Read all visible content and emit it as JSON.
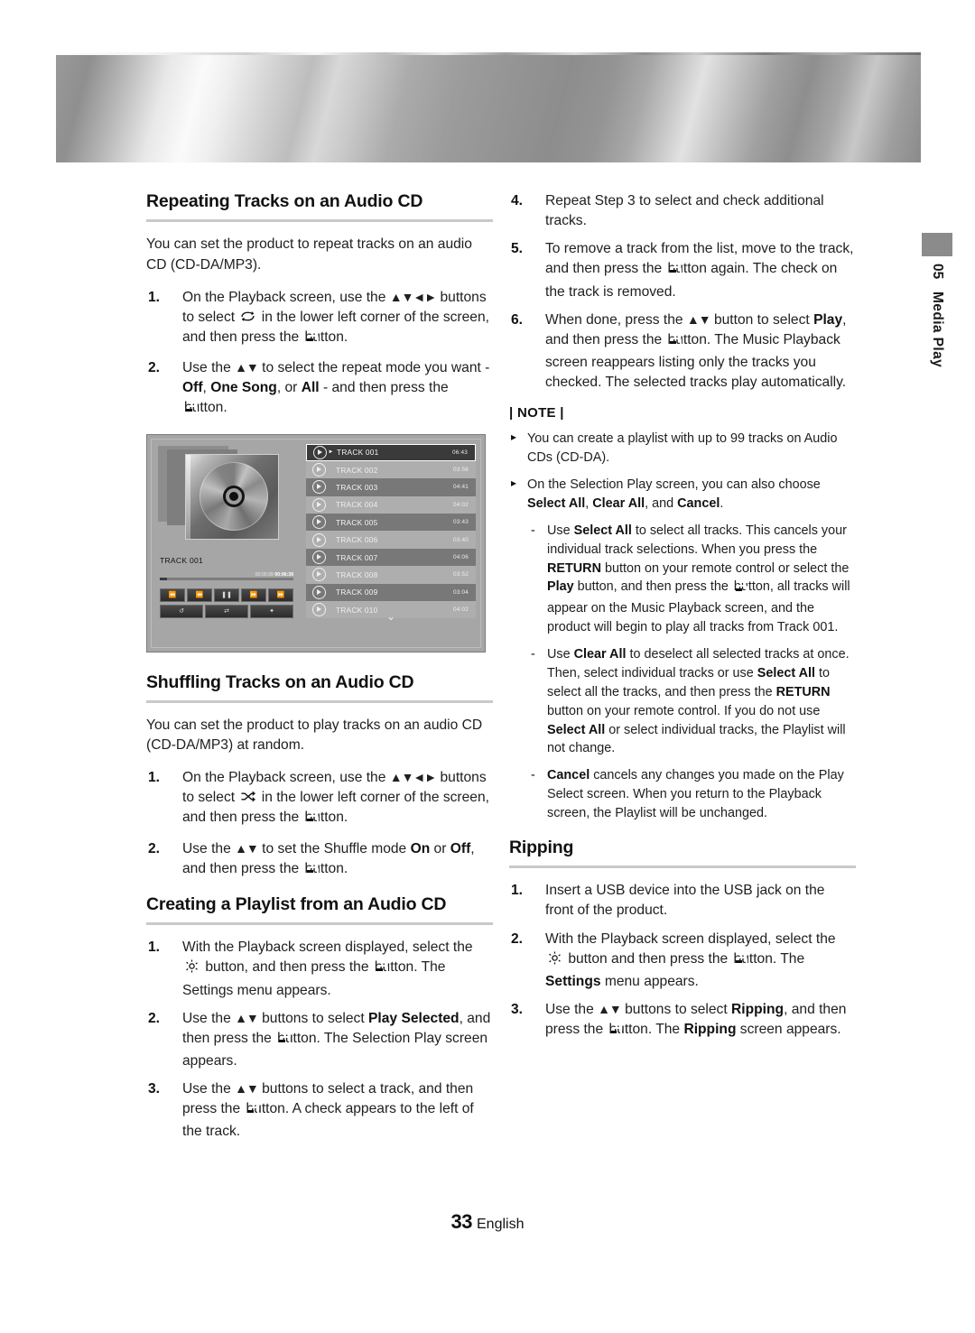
{
  "side_tab": {
    "number": "05",
    "label": "Media Play"
  },
  "footer": {
    "page_number": "33",
    "language": "English"
  },
  "left_column": {
    "section1": {
      "title": "Repeating Tracks on an Audio CD",
      "intro": "You can set the product to repeat tracks on an audio CD (CD-DA/MP3).",
      "step1_num": "1.",
      "step1_a": "On the Playback screen, use the ",
      "step1_arrows": "▲▼◄►",
      "step1_b": " buttons to select ",
      "step1_c": " in the lower left corner of the screen, and then press the ",
      "step1_d": " button.",
      "step2_num": "2.",
      "step2_a": "Use the ",
      "step2_arrows": "▲▼",
      "step2_b": " to select the repeat mode you want - ",
      "step2_off": "Off",
      "step2_c": ", ",
      "step2_onesong": "One Song",
      "step2_d": ", or ",
      "step2_all": "All",
      "step2_e": " - and then press the ",
      "step2_f": " button."
    },
    "section2": {
      "title": "Shuffling Tracks on an Audio CD",
      "intro": "You can set the product to play tracks on an audio CD (CD-DA/MP3) at random.",
      "step1_num": "1.",
      "step1_a": "On the Playback screen, use the ",
      "step1_arrows": "▲▼◄►",
      "step1_b": " buttons to select ",
      "step1_c": " in the lower left corner of the screen, and then press the ",
      "step1_d": " button.",
      "step2_num": "2.",
      "step2_a": "Use the ",
      "step2_arrows": "▲▼",
      "step2_b": " to set the Shuffle mode ",
      "step2_on": "On",
      "step2_c": " or ",
      "step2_off": "Off",
      "step2_d": ", and then press the ",
      "step2_e": " button."
    },
    "section3": {
      "title": "Creating a Playlist from an Audio CD",
      "step1_num": "1.",
      "step1_a": "With the Playback screen displayed, select the ",
      "step1_b": " button, and then press the ",
      "step1_c": " button. The Settings menu appears.",
      "step2_num": "2.",
      "step2_a": "Use the ",
      "step2_arrows": "▲▼",
      "step2_b": " buttons to select ",
      "step2_bold": "Play Selected",
      "step2_c": ", and then press the ",
      "step2_d": " button. The Selection Play screen appears.",
      "step3_num": "3.",
      "step3_a": "Use the ",
      "step3_arrows": "▲▼",
      "step3_b": " buttons to select a track, and then press the ",
      "step3_c": " button. A check appears to the left of the track."
    },
    "figure": {
      "album_label": "TRACK 001",
      "time_elapsed": "00:00:39",
      "time_total": "00:06:39",
      "controls_row1": [
        "skip-back-icon",
        "rewind-icon",
        "pause-icon",
        "fast-forward-icon",
        "skip-forward-icon"
      ],
      "controls_row2": [
        "repeat-icon",
        "shuffle-icon",
        "settings-icon"
      ],
      "tracks": [
        {
          "name": "TRACK 001",
          "time": "06:43",
          "selected": true,
          "playing": true
        },
        {
          "name": "TRACK 002",
          "time": "03:56",
          "selected": false,
          "playing": false
        },
        {
          "name": "TRACK 003",
          "time": "04:41",
          "selected": false,
          "playing": false
        },
        {
          "name": "TRACK 004",
          "time": "04:02",
          "selected": false,
          "playing": false
        },
        {
          "name": "TRACK 005",
          "time": "03:43",
          "selected": false,
          "playing": false
        },
        {
          "name": "TRACK 006",
          "time": "03:40",
          "selected": false,
          "playing": false
        },
        {
          "name": "TRACK 007",
          "time": "04:06",
          "selected": false,
          "playing": false
        },
        {
          "name": "TRACK 008",
          "time": "03:52",
          "selected": false,
          "playing": false
        },
        {
          "name": "TRACK 009",
          "time": "03:04",
          "selected": false,
          "playing": false
        },
        {
          "name": "TRACK 010",
          "time": "04:02",
          "selected": false,
          "playing": false
        }
      ]
    }
  },
  "right_column": {
    "step4_num": "4.",
    "step4_text": "Repeat Step 3 to select and check additional tracks.",
    "step5_num": "5.",
    "step5_a": "To remove a track from the list, move to the track, and then press the ",
    "step5_b": " button again. The check on the track is removed.",
    "step6_num": "6.",
    "step6_a": "When done, press the ",
    "step6_arrows": "▲▼",
    "step6_b": " button to select ",
    "step6_play": "Play",
    "step6_c": ", and then press the ",
    "step6_d": " button. The Music Playback screen reappears listing only the tracks you checked. The selected tracks play automatically.",
    "note": {
      "heading": "| NOTE |",
      "bullet1": "You can create a playlist with up to 99 tracks on Audio CDs (CD-DA).",
      "bullet2_a": "On the Selection Play screen, you can also choose ",
      "bullet2_selectall": "Select All",
      "bullet2_b": ", ",
      "bullet2_clearall": "Clear All",
      "bullet2_c": ", and ",
      "bullet2_cancel": "Cancel",
      "bullet2_d": ".",
      "sub1_a": "Use ",
      "sub1_selectall": "Select All",
      "sub1_b": " to select all tracks. This cancels your individual track selections. When you press the ",
      "sub1_return": "RETURN",
      "sub1_c": " button on your remote control or select the ",
      "sub1_play": "Play",
      "sub1_d": " button, and then press the ",
      "sub1_e": " button, all tracks will appear on the Music Playback screen, and the product will begin to play all tracks from Track 001.",
      "sub2_a": "Use ",
      "sub2_clearall": "Clear All",
      "sub2_b": " to deselect all selected tracks at once. Then, select individual tracks or use ",
      "sub2_selectall": "Select All",
      "sub2_c": " to select all the tracks, and then press the ",
      "sub2_return": "RETURN",
      "sub2_d": " button on your remote control. If you do not use ",
      "sub2_selectall2": "Select All",
      "sub2_e": " or select individual tracks, the Playlist will not change.",
      "sub3_cancel": "Cancel",
      "sub3_a": " cancels any changes you made on the Play Select screen. When you return to the Playback screen, the Playlist will be unchanged."
    },
    "ripping": {
      "title": "Ripping",
      "step1_num": "1.",
      "step1_text": "Insert a USB device into the USB jack on the front of the product.",
      "step2_num": "2.",
      "step2_a": "With the Playback screen displayed, select the ",
      "step2_b": " button and then press the ",
      "step2_c": " button. The ",
      "step2_settings": "Settings",
      "step2_d": " menu appears.",
      "step3_num": "3.",
      "step3_a": "Use the ",
      "step3_arrows": "▲▼",
      "step3_b": " buttons to select ",
      "step3_ripping": "Ripping",
      "step3_c": ", and then press the ",
      "step3_d": " button. The ",
      "step3_ripping2": "Ripping",
      "step3_e": " screen appears."
    }
  }
}
